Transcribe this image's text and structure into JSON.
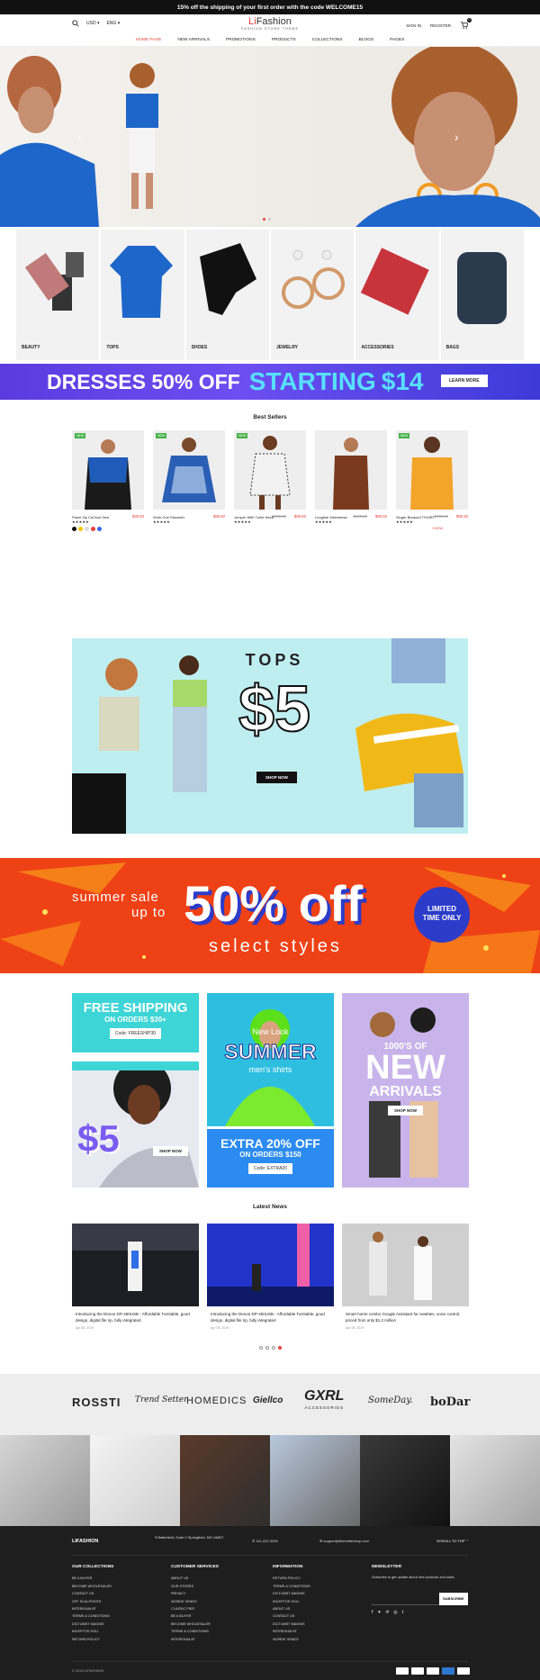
{
  "announcement": "15% off the shipping of your first order with the code WELCOME15",
  "header": {
    "currency": "USD",
    "language": "ENG",
    "brand_prefix": "Li",
    "brand_suffix": "Fashion",
    "tagline": "FASHION STORE THEME",
    "sign_in": "SIGN IN",
    "register": "REGISTER",
    "cart_count": "0"
  },
  "nav": [
    "HOME PAGE",
    "NEW ARRIVALS",
    "PROMOTIONS",
    "PRODUCTS",
    "COLLECTIONS",
    "BLOGS",
    "PAGES"
  ],
  "categories": [
    "BEAUTY",
    "TOPS",
    "SHOES",
    "JEWELRY",
    "ACCESSORIES",
    "BAGS"
  ],
  "promo_dresses": {
    "text1": "DRESSES 50% OFF",
    "text2": "STARTING",
    "price": "14",
    "button": "LEARN MORE"
  },
  "best_sellers": {
    "title": "Best Sellers",
    "products": [
      {
        "name": "Panel Zip Cut And Sew",
        "price": "$38.50",
        "old": "",
        "badge": "NEW"
      },
      {
        "name": "Work One Shoulder",
        "price": "$98.50",
        "old": "",
        "badge": "NEW"
      },
      {
        "name": "Jumper With Turtle Neck",
        "price": "$98.50",
        "old": "$108.50",
        "badge": "NEW"
      },
      {
        "name": "Longline Sleeveless",
        "price": "$98.50",
        "old": "$108.50",
        "badge": ""
      },
      {
        "name": "Singer Breaced TSHIRT",
        "price": "$98.50",
        "old": "$108.50",
        "badge": "NEW"
      }
    ],
    "more": "+VIEW"
  },
  "tops_banner": {
    "title": "TOPS",
    "price": "$5",
    "button": "SHOP NOW"
  },
  "summer_banner": {
    "line1": "summer sale",
    "line2": "up to",
    "big": "50% off",
    "line3": "select styles",
    "badge1": "LIMITED",
    "badge2": "TIME ONLY"
  },
  "tiles": {
    "free_shipping": "FREE SHIPPING",
    "on_orders": "ON ORDERS $30+",
    "code1": "Code: FREESHIP30",
    "five": "$5",
    "shop_now": "SHOP NOW",
    "new_look": "New Look",
    "summer": "SUMMER",
    "mens": "men's shirts",
    "extra": "EXTRA 20% OFF",
    "on_orders2": "ON ORDERS $150",
    "code2": "Code: EXTRA20",
    "hundreds": "1000'S OF",
    "new": "NEW",
    "arrivals": "ARRIVALS",
    "shop_now2": "SHOP NOW"
  },
  "news": {
    "title": "Latest News",
    "items": [
      {
        "title": "Introducing the Denon DP-450USB - Affordable Turntable, good design, digital file rip, fully integrated",
        "date": "Apr 08, 2019"
      },
      {
        "title": "Introducing the Denon DP-450USB - Affordable Turntable, good design, digital file rip, fully integrated",
        "date": "Apr 08, 2019"
      },
      {
        "title": "Smart home combo Google Assistant for newbies, voice control, priced from only $1.2 million",
        "date": "Apr 08, 2019"
      }
    ]
  },
  "brands": [
    "ROSSTI",
    "Trend Setter",
    "HOMEDICS",
    "Giellco",
    "GXRL",
    "SomeDay.",
    "boDar"
  ],
  "brand_sub": "ACCESSORIES",
  "footer": {
    "brand": "LIFASHION",
    "address": "Battlefield, Suite 0 Springfield, MO 66807",
    "phone": "111-222-3333",
    "email": "support@themefarshop.com",
    "scroll": "SCROLL TO TOP",
    "cols": [
      {
        "title": "OUR COLLECTIONS",
        "items": [
          "BE A BUYER",
          "BECOME WHOLESALER",
          "CONTACT US",
          "OFF SCALPOSITE",
          "INTERIOUM AT",
          "TERMS & CONDITIONS",
          "DICTUMST MAGNIS",
          "INCEPTOS SOLI",
          "RETURN POLICY"
        ]
      },
      {
        "title": "CUSTOMER SERVICES",
        "items": [
          "ABOUT US",
          "OUR STORES",
          "PRIVACY",
          "WORDE VENDS",
          "CLASSIC PIER",
          "BE A BUYER",
          "BECOME WHOLESALER",
          "TERMS & CONDITIONS",
          "INTERIOUM AT"
        ]
      },
      {
        "title": "INFORMATION",
        "items": [
          "RETURN POLICY",
          "TERMS & CONDITIONS",
          "DICTUMST MAGNIS",
          "INCEPTOS SOLI",
          "ABOUT US",
          "CONTACT US",
          "DICTUMST MAGNIS",
          "INTERIOUM AT",
          "WORDE VENDS"
        ]
      }
    ],
    "newsletter_title": "NEWSLETTER",
    "newsletter_text": "Subscribe to get update about new products and sales",
    "subscribe": "SUBSCRIBE",
    "copyright": "© 2019 LIFASHION"
  }
}
